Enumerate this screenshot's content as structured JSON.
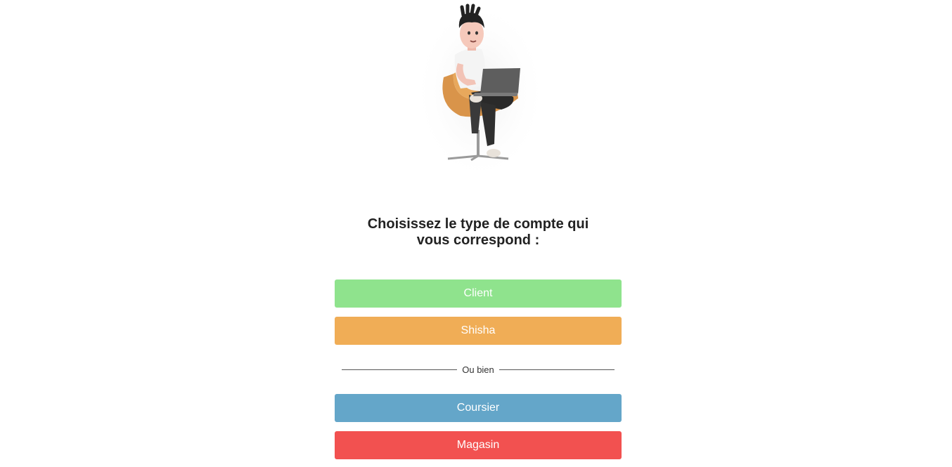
{
  "heading": {
    "line1": "Choisissez le type de compte qui",
    "line2": "vous correspond :"
  },
  "buttons": {
    "client": "Client",
    "shisha": "Shisha",
    "coursier": "Coursier",
    "magasin": "Magasin"
  },
  "divider": {
    "label": "Ou bien"
  },
  "colors": {
    "client": "#8fe38d",
    "shisha": "#f0ad56",
    "coursier": "#64a6c9",
    "magasin": "#f25150"
  },
  "illustration": {
    "icon": "person-with-laptop-illustration"
  }
}
